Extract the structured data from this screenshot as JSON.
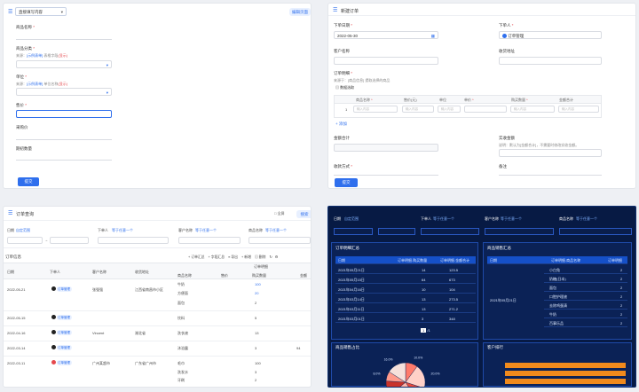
{
  "colors": {
    "accent": "#2f6fed",
    "required": "#e5484d",
    "dashboard_bg": "#071a44",
    "bar_orange": "#f08a1c"
  },
  "product_form": {
    "title": "直接填写内容",
    "top_button": "编辑页面",
    "fields": [
      {
        "label": "商品名称",
        "required": true
      },
      {
        "label": "商品分类",
        "required": true,
        "hint_prefix": "来源：",
        "hint_link": "[示例表单]",
        "hint_mid": "表格字段",
        "hint_tag": "(显示)"
      },
      {
        "label": "单位",
        "required": true,
        "hint_prefix": "来源：",
        "hint_link": "[示例表单]",
        "hint_mid": "单位名称",
        "hint_tag": "(显示)"
      },
      {
        "label": "售价",
        "required": true
      },
      {
        "label": "采购价",
        "required": false
      },
      {
        "label": "期初数量",
        "required": false
      }
    ],
    "submit": "提交"
  },
  "order_form": {
    "title": "新建订单",
    "order_date_label": "下单日期",
    "order_date_value": "2022-05-30",
    "buyer_label": "下单人",
    "buyer_value": "订单管理",
    "customer_label": "客户名称",
    "address_label": "收货地址",
    "detail_label": "订单明细",
    "detail_hint": "来源于：[商品信息]  提取选择的商品",
    "data_pick": "数据选取",
    "columns": [
      "商品名称",
      "售价(元)",
      "单位",
      "单价",
      "购买数量",
      "金额合计"
    ],
    "row_no": "1",
    "row_placeholders": [
      "输入内容",
      "输入内容",
      "输入内容",
      "",
      "输入内容",
      "输入内容"
    ],
    "add_row": "+ 添加",
    "total_label": "金额合计",
    "paid_label": "实收金额",
    "paid_hint": "说明：默认为[金额合计]，不需要时修改实收金额。",
    "pay_label": "收款方式",
    "note_label": "备注",
    "submit": "提交"
  },
  "order_table": {
    "title": "订单查询",
    "btn_export": "□ 全屏",
    "btn_filter": "搜索",
    "filter_date_label": "日期",
    "filter_date_value": "自定范围",
    "filter_buyer_label": "下单人",
    "filter_buyer_value": "等于任意一个",
    "filter_customer_label": "客户名称",
    "filter_customer_value": "等于任意一个",
    "filter_product_label": "商品名称",
    "filter_product_value": "等于任意一个",
    "section_label": "订单信息",
    "toolbar": [
      "+ 订单汇总",
      "+ 字段汇总",
      "≡ 导出",
      "+ 新增",
      "▤ 删除"
    ],
    "headers": [
      "日期",
      "下单人",
      "客户名称",
      "收货地址",
      "商品名称",
      "售价",
      "订单明细",
      "购买数量",
      "金额"
    ],
    "rows": [
      {
        "date": "2022-05-21",
        "buyer": "订单管理",
        "customer": "张强强",
        "address": "江西省南昌市小区",
        "items": [
          [
            "牛奶",
            "100"
          ],
          [
            "方便面",
            "20"
          ],
          [
            "面包",
            "2"
          ]
        ]
      },
      {
        "date": "2022-05-15",
        "buyer": "订单管理",
        "customer": "",
        "address": "",
        "items": [
          [
            "饮料",
            "5"
          ]
        ]
      },
      {
        "date": "2022-04-16",
        "buyer": "订单管理",
        "customer": "Vincent",
        "address": "湖北省",
        "items": [
          [
            "洗衣液",
            "13"
          ]
        ]
      },
      {
        "date": "2022-03-14",
        "buyer": "订单管理",
        "customer": "",
        "address": "",
        "items": [
          [
            "沐浴露",
            "3"
          ]
        ]
      },
      {
        "date": "2022-03-11",
        "buyer": "订单管理",
        "customer": "广州某超市",
        "address": "广东省广州市",
        "items": [
          [
            "毛巾",
            "100"
          ],
          [
            "洗发水",
            "3"
          ],
          [
            "牙刷",
            "2"
          ],
          [
            "牙膏",
            "3"
          ]
        ]
      }
    ],
    "amounts": [
      "94"
    ]
  },
  "dashboard": {
    "filter_date_label": "日期",
    "filter_date_value": "自定范围",
    "filter_buyer_label": "下单人",
    "filter_buyer_value": "等于任意一个",
    "filter_customer_label": "客户名称",
    "filter_customer_value": "等于任意一个",
    "filter_product_label": "商品名称",
    "filter_product_value": "等于任意一个",
    "left_table_title": "订单明细汇总",
    "left_headers": [
      "日期",
      "订单明细.购买数量",
      "订单明细.金额合计"
    ],
    "left_rows": [
      [
        "2021年05月21日",
        "14",
        "123.5"
      ],
      [
        "2021年05月15日",
        "64",
        "673"
      ],
      [
        "2021年04月16日",
        "10",
        "104"
      ],
      [
        "2021年03月14日",
        "13",
        "273.5"
      ],
      [
        "2021年03月11日",
        "13",
        "271.2"
      ],
      [
        "2021年03月01日",
        "3",
        "348"
      ]
    ],
    "pager": [
      "1",
      "/1"
    ],
    "right_table_title": "商品销售汇总",
    "right_headers": [
      "日期",
      "订单明细.商品名称",
      "订单明细"
    ],
    "right_date": "2021年05月21日",
    "right_rows": [
      [
        "小白兔",
        "2"
      ],
      [
        "奶糖(日本)",
        "2"
      ],
      [
        "面包",
        "2"
      ],
      [
        "口腔护理液",
        "2"
      ],
      [
        "去除鸡蛋清",
        "2"
      ],
      [
        "牛奶",
        "2"
      ],
      [
        "百事乐品",
        "2"
      ]
    ],
    "pie_title": "商品销售占比",
    "bar_title": "客户排行"
  },
  "chart_data": {
    "type": "pie",
    "title": "商品销售占比",
    "labels": [
      "10.0%",
      "20.0%",
      "11.0%",
      "23.0%",
      "12.0%",
      "8.0%",
      "16.0%"
    ],
    "values": [
      10,
      20,
      11,
      23,
      12,
      8,
      16
    ]
  }
}
